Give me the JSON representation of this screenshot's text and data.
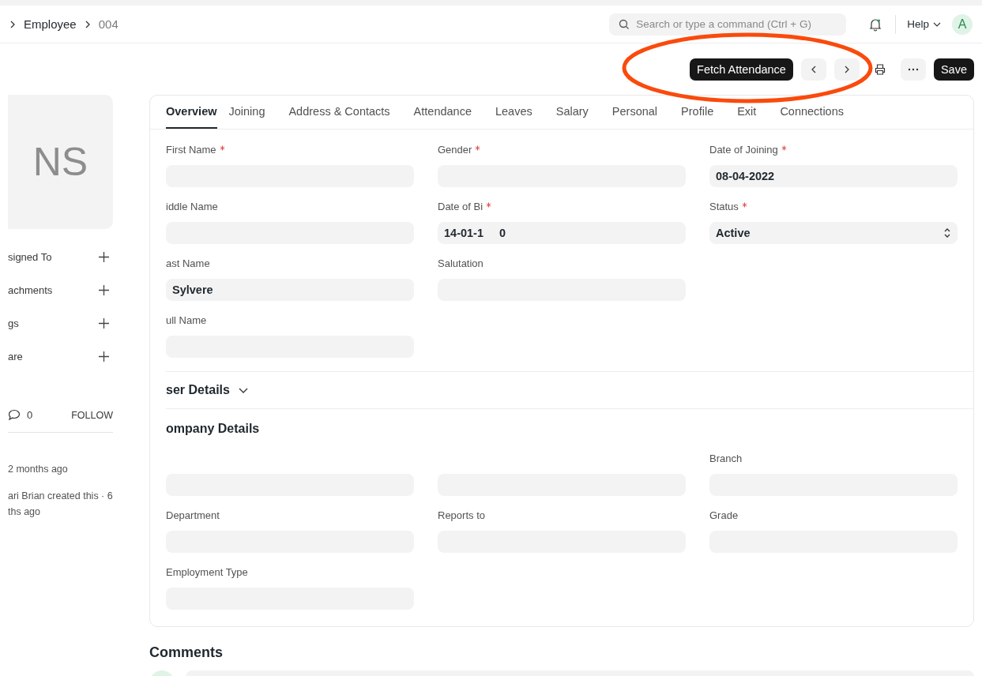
{
  "breadcrumbs": [
    {
      "label": "Employee",
      "current": false
    },
    {
      "label": "004",
      "current": true
    }
  ],
  "search": {
    "placeholder": "Search or type a command (Ctrl + G)"
  },
  "help": "Help",
  "user_avatar": "A",
  "actions": {
    "primary": "Fetch Attendance",
    "save": "Save"
  },
  "sidebar": {
    "avatar": "NS",
    "items": [
      {
        "label": "signed To"
      },
      {
        "label": "achments"
      },
      {
        "label": "gs"
      },
      {
        "label": "are"
      }
    ],
    "comments_count": "0",
    "follow": "FOLLOW",
    "activity": [
      "2 months ago",
      "ari Brian created this · 6",
      "ths ago"
    ]
  },
  "tabs": [
    {
      "label": "Overview",
      "selected": true
    },
    {
      "label": "Joining",
      "selected": false
    },
    {
      "label": "Address & Contacts",
      "selected": false
    },
    {
      "label": "Attendance",
      "selected": false
    },
    {
      "label": "Leaves",
      "selected": false
    },
    {
      "label": "Salary",
      "selected": false
    },
    {
      "label": "Personal",
      "selected": false
    },
    {
      "label": "Profile",
      "selected": false
    },
    {
      "label": "Exit",
      "selected": false
    },
    {
      "label": "Connections",
      "selected": false
    }
  ],
  "sections": [
    {
      "kind": "fields",
      "columns": [
        [
          {
            "label": "First Name",
            "required": true
          },
          {
            "label": "iddle Name",
            "required": false
          },
          {
            "label": "ast Name",
            "required": false,
            "value": "Sylvere"
          },
          {
            "label": "ull Name",
            "required": false
          }
        ],
        [
          {
            "label": "Gender",
            "required": true
          },
          {
            "label": "Date of Bi",
            "required": true,
            "value": "14-01-1",
            "value_tail": "0"
          },
          {
            "label": "Salutation",
            "required": false
          }
        ],
        [
          {
            "label": "Date of Joining",
            "required": true,
            "value": "08-04-2022"
          },
          {
            "label": "Status",
            "required": true,
            "value": "Active",
            "kind": "select"
          }
        ]
      ]
    },
    {
      "kind": "collapsible",
      "title": "ser Details",
      "expanded": false
    },
    {
      "kind": "heading",
      "title": "ompany Details"
    },
    {
      "kind": "fields",
      "columns": [
        [
          {},
          {
            "label": "Department",
            "required": false
          },
          {
            "label": "Employment Type",
            "required": false
          }
        ],
        [
          {},
          {
            "label": "Reports to",
            "required": false
          }
        ],
        [
          {
            "label": "Branch",
            "required": false
          },
          {
            "label": "Grade",
            "required": false
          }
        ]
      ]
    }
  ],
  "comments_title": "Comments"
}
